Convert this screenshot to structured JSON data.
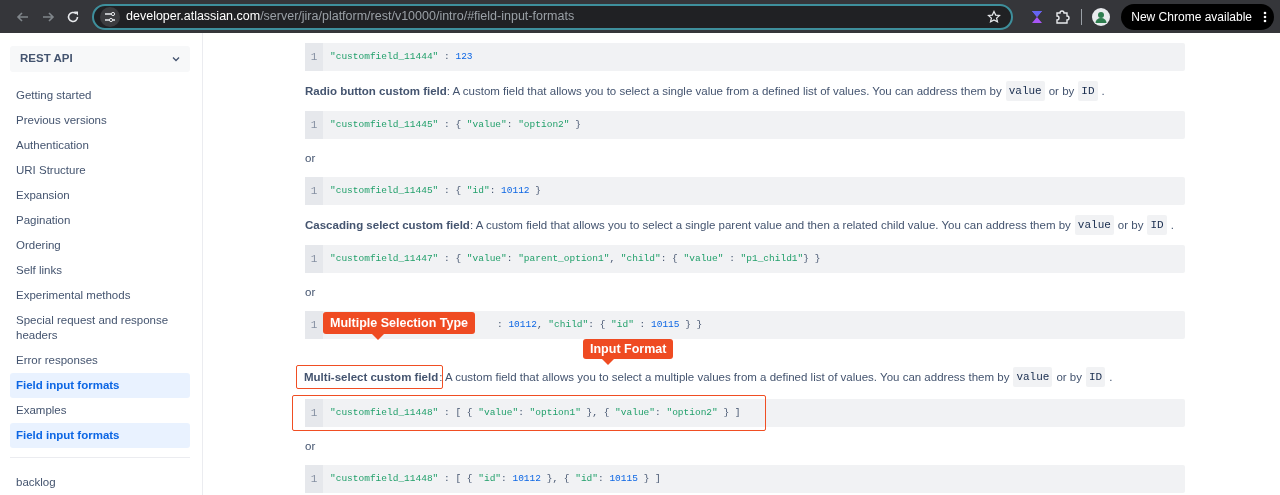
{
  "browser": {
    "url_host": "developer.atlassian.com",
    "url_path": "/server/jira/platform/rest/v10000/intro/#field-input-formats",
    "update_button": "New Chrome available"
  },
  "sidebar": {
    "dropdown": "REST API",
    "items": [
      {
        "label": "Getting started",
        "selected": false
      },
      {
        "label": "Previous versions",
        "selected": false
      },
      {
        "label": "Authentication",
        "selected": false
      },
      {
        "label": "URI Structure",
        "selected": false
      },
      {
        "label": "Expansion",
        "selected": false
      },
      {
        "label": "Pagination",
        "selected": false
      },
      {
        "label": "Ordering",
        "selected": false
      },
      {
        "label": "Self links",
        "selected": false
      },
      {
        "label": "Experimental methods",
        "selected": false
      },
      {
        "label": "Special request and response headers",
        "selected": false
      },
      {
        "label": "Error responses",
        "selected": false
      },
      {
        "label": "Field input formats",
        "selected": true
      },
      {
        "label": "Examples",
        "selected": false
      },
      {
        "label": "Field input formats",
        "selected": true
      }
    ],
    "footer_item": "backlog"
  },
  "content": [
    {
      "kind": "code",
      "line": "1",
      "framed": false,
      "tokens": [
        {
          "kind": "str",
          "text": "\"customfield_11444\""
        },
        {
          "kind": "punct",
          "text": " : "
        },
        {
          "kind": "num",
          "text": "123"
        }
      ]
    },
    {
      "kind": "paragraph",
      "term": "Radio button custom field",
      "framed": false,
      "parts": [
        {
          "kind": "text",
          "text": ": A custom field that allows you to select a single value from a defined list of values. You can address them by"
        },
        {
          "kind": "code",
          "text": "value"
        },
        {
          "kind": "text",
          "text": "or by"
        },
        {
          "kind": "code",
          "text": "ID"
        },
        {
          "kind": "text",
          "text": "."
        }
      ]
    },
    {
      "kind": "code",
      "line": "1",
      "framed": false,
      "tokens": [
        {
          "kind": "str",
          "text": "\"customfield_11445\""
        },
        {
          "kind": "punct",
          "text": " : { "
        },
        {
          "kind": "str",
          "text": "\"value\""
        },
        {
          "kind": "punct",
          "text": ": "
        },
        {
          "kind": "str",
          "text": "\"option2\""
        },
        {
          "kind": "punct",
          "text": " }"
        }
      ]
    },
    {
      "kind": "or",
      "text": "or"
    },
    {
      "kind": "code",
      "line": "1",
      "framed": false,
      "tokens": [
        {
          "kind": "str",
          "text": "\"customfield_11445\""
        },
        {
          "kind": "punct",
          "text": " : { "
        },
        {
          "kind": "str",
          "text": "\"id\""
        },
        {
          "kind": "punct",
          "text": ": "
        },
        {
          "kind": "num",
          "text": "10112"
        },
        {
          "kind": "punct",
          "text": " }"
        }
      ]
    },
    {
      "kind": "paragraph",
      "term": "Cascading select custom field",
      "framed": false,
      "parts": [
        {
          "kind": "text",
          "text": ": A custom field that allows you to select a single parent value and then a related child value. You can address them by"
        },
        {
          "kind": "code",
          "text": "value"
        },
        {
          "kind": "text",
          "text": "or by"
        },
        {
          "kind": "code",
          "text": "ID"
        },
        {
          "kind": "text",
          "text": "."
        }
      ]
    },
    {
      "kind": "code",
      "line": "1",
      "framed": false,
      "tokens": [
        {
          "kind": "str",
          "text": "\"customfield_11447\""
        },
        {
          "kind": "punct",
          "text": " : { "
        },
        {
          "kind": "str",
          "text": "\"value\""
        },
        {
          "kind": "punct",
          "text": ": "
        },
        {
          "kind": "str",
          "text": "\"parent_option1\""
        },
        {
          "kind": "punct",
          "text": ", "
        },
        {
          "kind": "str",
          "text": "\"child\""
        },
        {
          "kind": "punct",
          "text": ": { "
        },
        {
          "kind": "str",
          "text": "\"value\""
        },
        {
          "kind": "punct",
          "text": " : "
        },
        {
          "kind": "str",
          "text": "\"p1_child1\""
        },
        {
          "kind": "punct",
          "text": "} }"
        }
      ]
    },
    {
      "kind": "or",
      "text": "or"
    },
    {
      "kind": "code",
      "line": "1",
      "framed": false,
      "callout": "Multiple Selection Type",
      "tokens": [
        {
          "kind": "punct",
          "text": ": "
        },
        {
          "kind": "num",
          "text": "10112"
        },
        {
          "kind": "punct",
          "text": ", "
        },
        {
          "kind": "str",
          "text": "\"child\""
        },
        {
          "kind": "punct",
          "text": ": { "
        },
        {
          "kind": "str",
          "text": "\"id\""
        },
        {
          "kind": "punct",
          "text": " : "
        },
        {
          "kind": "num",
          "text": "10115"
        },
        {
          "kind": "punct",
          "text": " } }"
        }
      ]
    },
    {
      "kind": "paragraph",
      "term": "Multi-select custom field",
      "framed": true,
      "callout": "Input Format",
      "parts": [
        {
          "kind": "text",
          "text": ": A custom field that allows you to select a multiple values from a defined list of values. You can address them by"
        },
        {
          "kind": "code",
          "text": "value"
        },
        {
          "kind": "text",
          "text": "or by"
        },
        {
          "kind": "code",
          "text": "ID"
        },
        {
          "kind": "text",
          "text": "."
        }
      ]
    },
    {
      "kind": "code",
      "line": "1",
      "framed": true,
      "tokens": [
        {
          "kind": "str",
          "text": "\"customfield_11448\""
        },
        {
          "kind": "punct",
          "text": " : [ { "
        },
        {
          "kind": "str",
          "text": "\"value\""
        },
        {
          "kind": "punct",
          "text": ": "
        },
        {
          "kind": "str",
          "text": "\"option1\""
        },
        {
          "kind": "punct",
          "text": " }, { "
        },
        {
          "kind": "str",
          "text": "\"value\""
        },
        {
          "kind": "punct",
          "text": ": "
        },
        {
          "kind": "str",
          "text": "\"option2\""
        },
        {
          "kind": "punct",
          "text": " } ]"
        }
      ]
    },
    {
      "kind": "or",
      "text": "or"
    },
    {
      "kind": "code",
      "line": "1",
      "framed": false,
      "tokens": [
        {
          "kind": "str",
          "text": "\"customfield_11448\""
        },
        {
          "kind": "punct",
          "text": " : [ { "
        },
        {
          "kind": "str",
          "text": "\"id\""
        },
        {
          "kind": "punct",
          "text": ": "
        },
        {
          "kind": "num",
          "text": "10112"
        },
        {
          "kind": "punct",
          "text": " }, { "
        },
        {
          "kind": "str",
          "text": "\"id\""
        },
        {
          "kind": "punct",
          "text": ": "
        },
        {
          "kind": "num",
          "text": "10115"
        },
        {
          "kind": "punct",
          "text": " } ]"
        }
      ]
    }
  ]
}
